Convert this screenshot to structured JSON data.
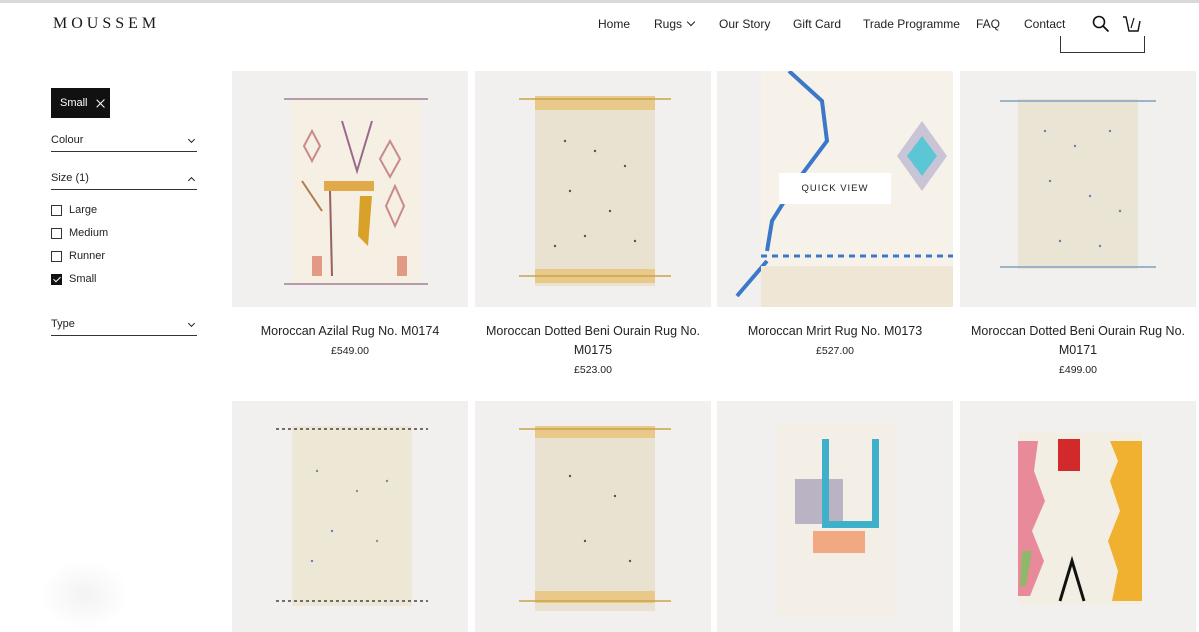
{
  "brand": {
    "name": "MOUSSEM"
  },
  "nav": {
    "items": [
      {
        "label": "Home"
      },
      {
        "label": "Rugs"
      },
      {
        "label": "Our Story"
      },
      {
        "label": "Gift Card"
      },
      {
        "label": "Trade Programme"
      },
      {
        "label": "FAQ"
      },
      {
        "label": "Contact"
      }
    ],
    "search_icon": "search-icon",
    "cart_icon": "cart-icon"
  },
  "filters": {
    "active_chip": "Small",
    "colour": {
      "label": "Colour"
    },
    "size": {
      "label": "Size (1)",
      "options": [
        {
          "label": "Large",
          "checked": false
        },
        {
          "label": "Medium",
          "checked": false
        },
        {
          "label": "Runner",
          "checked": false
        },
        {
          "label": "Small",
          "checked": true
        }
      ]
    },
    "type": {
      "label": "Type"
    }
  },
  "products": [
    {
      "title": "Moroccan Azilal Rug No. M0174",
      "price": "£549.00"
    },
    {
      "title": "Moroccan Dotted Beni Ourain Rug No. M0175",
      "price": "£523.00"
    },
    {
      "title": "Moroccan Mrirt Rug No. M0173",
      "price": "£527.00",
      "quick_view": "QUICK VIEW"
    },
    {
      "title": "Moroccan Dotted Beni Ourain Rug No. M0171",
      "price": "£499.00"
    },
    {
      "title": "",
      "price": ""
    },
    {
      "title": "",
      "price": ""
    },
    {
      "title": "",
      "price": ""
    },
    {
      "title": "",
      "price": ""
    }
  ],
  "colors": {
    "text": "#222222",
    "chip_bg": "#111111",
    "tile_bg": "#f1f0ee"
  }
}
